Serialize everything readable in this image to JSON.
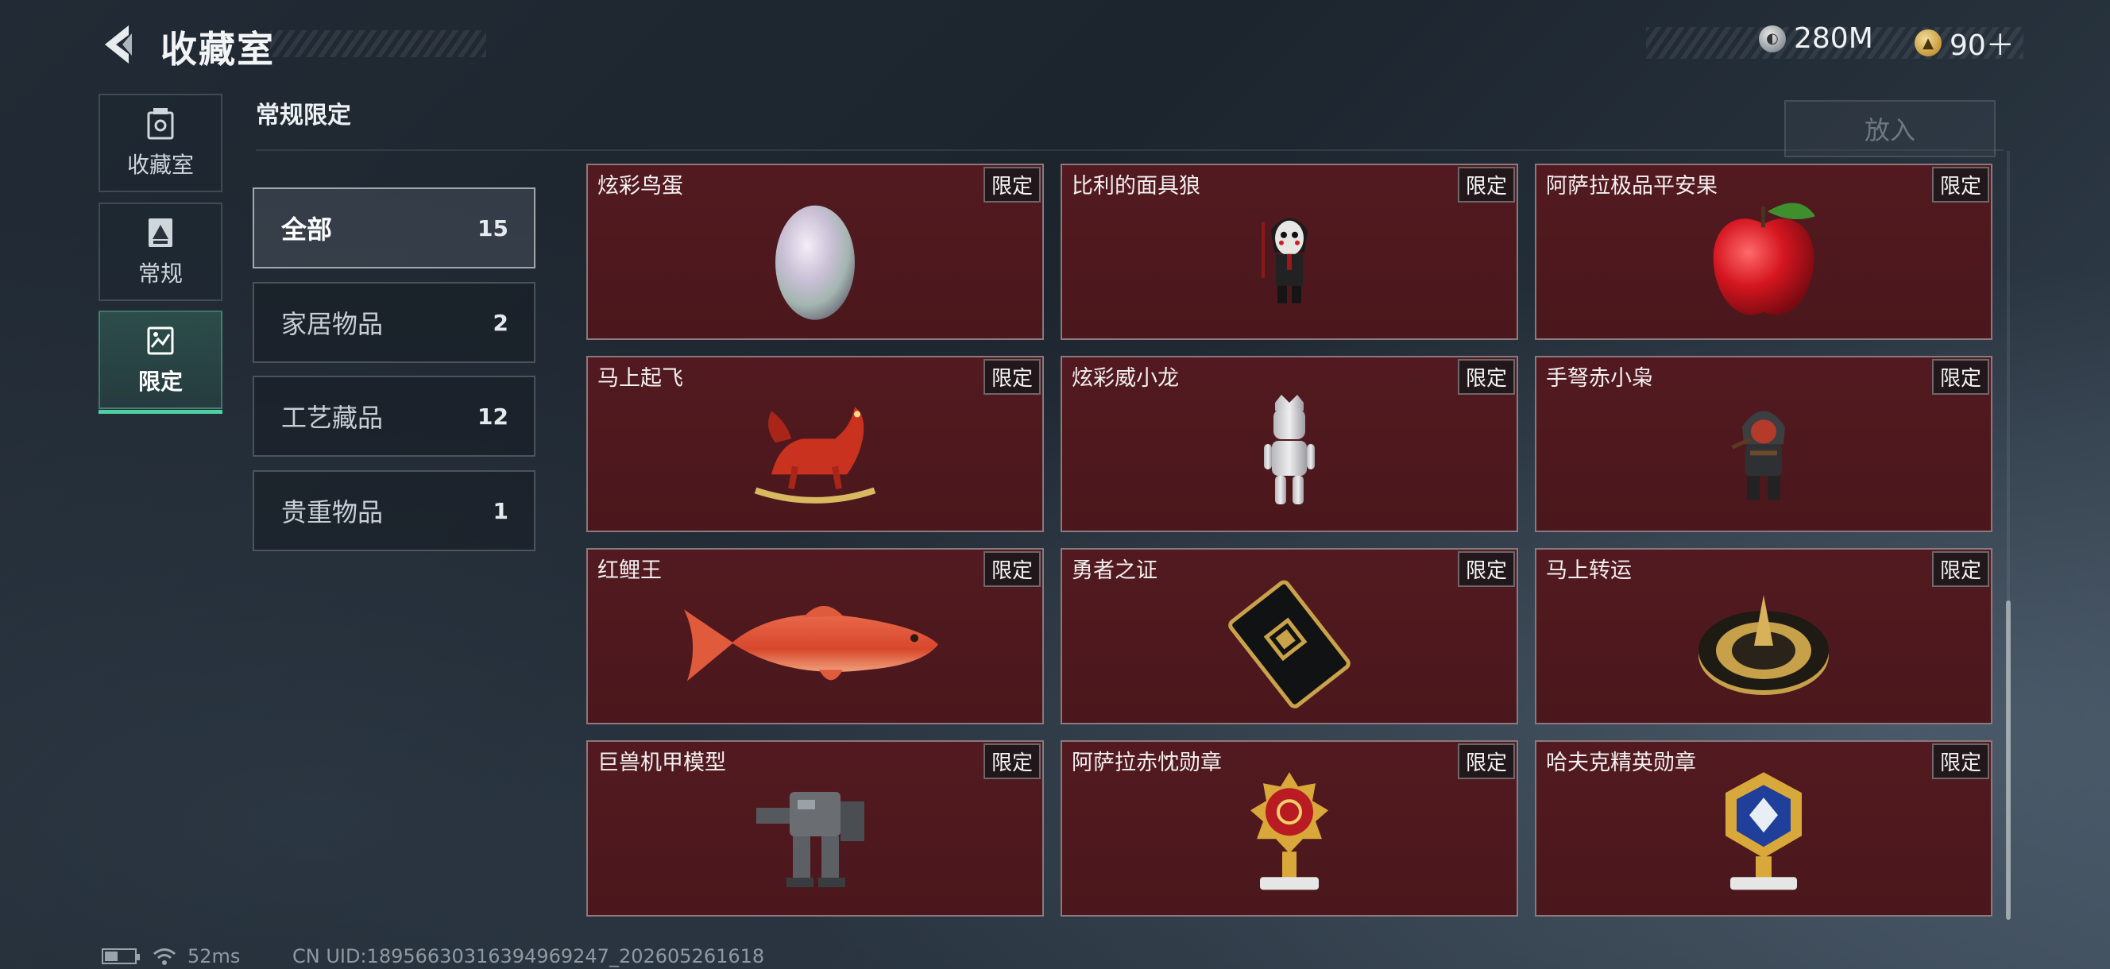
{
  "header": {
    "title": "收藏室",
    "currencies": [
      {
        "icon": "silver-coin-icon",
        "value": "280M"
      },
      {
        "icon": "gold-coin-icon",
        "value": "90＋"
      }
    ]
  },
  "nav": {
    "items": [
      {
        "label": "收藏室",
        "icon": "collection-room-icon",
        "active": false
      },
      {
        "label": "常规",
        "icon": "regular-card-icon",
        "active": false
      },
      {
        "label": "限定",
        "icon": "limited-card-icon",
        "active": true
      }
    ]
  },
  "section": {
    "title": "常规限定",
    "place_button": "放入"
  },
  "filters": [
    {
      "label": "全部",
      "count": "15",
      "active": true
    },
    {
      "label": "家居物品",
      "count": "2",
      "active": false
    },
    {
      "label": "工艺藏品",
      "count": "12",
      "active": false
    },
    {
      "label": "贵重物品",
      "count": "1",
      "active": false
    }
  ],
  "items": [
    {
      "name": "炫彩鸟蛋",
      "tag": "限定",
      "icon": "pearl-egg-icon"
    },
    {
      "name": "比利的面具狼",
      "tag": "限定",
      "icon": "puppet-figure-icon"
    },
    {
      "name": "阿萨拉极品平安果",
      "tag": "限定",
      "icon": "red-apple-icon"
    },
    {
      "name": "马上起飞",
      "tag": "限定",
      "icon": "rocking-horse-icon"
    },
    {
      "name": "炫彩威小龙",
      "tag": "限定",
      "icon": "silver-figure-icon"
    },
    {
      "name": "手弩赤小枭",
      "tag": "限定",
      "icon": "hooded-figure-icon"
    },
    {
      "name": "红鲤王",
      "tag": "限定",
      "icon": "red-carp-icon"
    },
    {
      "name": "勇者之证",
      "tag": "限定",
      "icon": "black-card-icon"
    },
    {
      "name": "马上转运",
      "tag": "限定",
      "icon": "gold-wheel-icon"
    },
    {
      "name": "巨兽机甲模型",
      "tag": "限定",
      "icon": "mech-model-icon"
    },
    {
      "name": "阿萨拉赤忱勋章",
      "tag": "限定",
      "icon": "red-medal-icon"
    },
    {
      "name": "哈夫克精英勋章",
      "tag": "限定",
      "icon": "blue-medal-icon"
    }
  ],
  "status": {
    "ping": "52ms",
    "uid": "CN UID:18956630316394969247_202605261618"
  },
  "colors": {
    "card_bg": "#521a20",
    "active_accent": "#4fd0a0"
  }
}
